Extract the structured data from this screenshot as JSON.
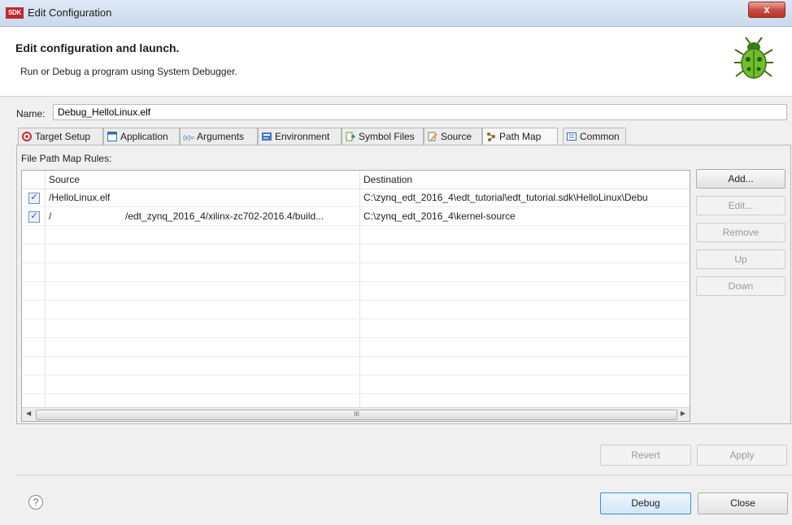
{
  "window": {
    "logo_text": "SDK",
    "title": "Edit Configuration",
    "close_glyph": "x"
  },
  "header": {
    "title": "Edit configuration and launch.",
    "description": "Run or Debug a program using System Debugger.",
    "icon": "bug-icon"
  },
  "name": {
    "label": "Name:",
    "value": "Debug_HelloLinux.elf"
  },
  "tabs": [
    {
      "label": "Target Setup",
      "icon": "target-icon",
      "active": false
    },
    {
      "label": "Application",
      "icon": "window-icon",
      "active": false
    },
    {
      "label": "Arguments",
      "icon": "arguments-icon",
      "active": false
    },
    {
      "label": "Environment",
      "icon": "environment-icon",
      "active": false
    },
    {
      "label": "Symbol Files",
      "icon": "symbol-files-icon",
      "active": false
    },
    {
      "label": "Source",
      "icon": "source-icon",
      "active": false
    },
    {
      "label": "Path Map",
      "icon": "path-map-icon",
      "active": true
    },
    {
      "label": "Common",
      "icon": "common-icon",
      "active": false
    }
  ],
  "path_map": {
    "section_label": "File Path Map Rules:",
    "columns": [
      "Source",
      "Destination"
    ],
    "rows": [
      {
        "checked": true,
        "source_prefix": "",
        "source": "/HelloLinux.elf",
        "destination": "C:\\zynq_edt_2016_4\\edt_tutorial\\edt_tutorial.sdk\\HelloLinux\\Debu"
      },
      {
        "checked": true,
        "source_prefix": "/",
        "source": "/edt_zynq_2016_4/xilinx-zc702-2016.4/build...",
        "destination": "C:\\zynq_edt_2016_4\\kernel-source"
      }
    ],
    "scroll_grip": "III"
  },
  "side_buttons": {
    "add": "Add...",
    "edit": "Edit...",
    "remove": "Remove",
    "up": "Up",
    "down": "Down"
  },
  "footer": {
    "revert": "Revert",
    "apply": "Apply",
    "help": "?",
    "debug": "Debug",
    "close": "Close"
  },
  "colors": {
    "accent": "#3c8ed6",
    "check": "#2a4fb5",
    "bug": "#6fbf2a"
  }
}
